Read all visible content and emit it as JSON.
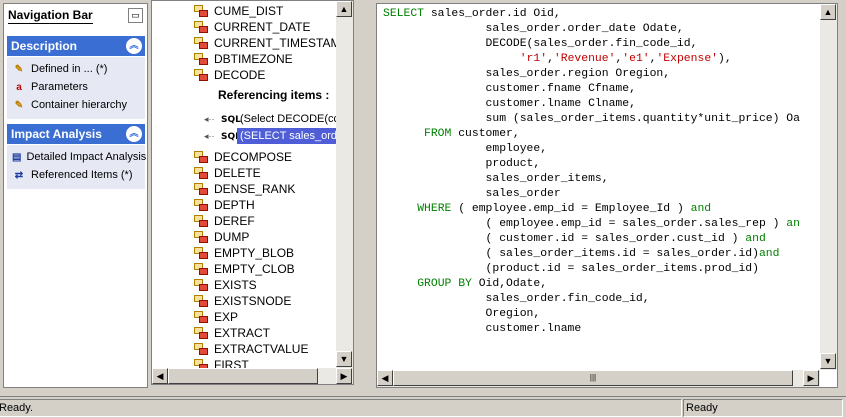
{
  "navigation": {
    "title": "Navigation Bar",
    "sections": [
      {
        "title": "Description",
        "items": [
          {
            "label": "Defined in ... (*)",
            "icon": "pencil-icon"
          },
          {
            "label": "Parameters",
            "icon": "parameter-icon"
          },
          {
            "label": "Container hierarchy",
            "icon": "pencil-icon"
          }
        ]
      },
      {
        "title": "Impact Analysis",
        "items": [
          {
            "label": "Detailed Impact Analysis",
            "icon": "impact-analysis-icon"
          },
          {
            "label": "Referenced Items (*)",
            "icon": "referenced-items-icon"
          }
        ]
      }
    ]
  },
  "list": {
    "top_items": [
      "CUME_DIST",
      "CURRENT_DATE",
      "CURRENT_TIMESTAMP",
      "DBTIMEZONE",
      "DECODE"
    ],
    "referencing_header": "Referencing items :",
    "references": [
      {
        "tag": "SQL",
        "label": "(Select DECODE(cc"
      },
      {
        "tag": "SQL",
        "label": "(SELECT sales_orde"
      }
    ],
    "bottom_items": [
      "DECOMPOSE",
      "DELETE",
      "DENSE_RANK",
      "DEPTH",
      "DEREF",
      "DUMP",
      "EMPTY_BLOB",
      "EMPTY_CLOB",
      "EXISTS",
      "EXISTSNODE",
      "EXP",
      "EXTRACT",
      "EXTRACTVALUE",
      "FIRST"
    ]
  },
  "editor": {
    "code_lines": [
      [
        {
          "t": "SELECT sales_order.id Oid,",
          "k": "kw-first"
        }
      ],
      [
        {
          "t": "               sales_order.order_date Odate,"
        }
      ],
      [
        {
          "t": "               DECODE(sales_order.fin_code_id,"
        }
      ],
      [
        {
          "t": "                    "
        },
        {
          "t": "'r1'",
          "c": "str"
        },
        {
          "t": ","
        },
        {
          "t": "'Revenue'",
          "c": "str"
        },
        {
          "t": ","
        },
        {
          "t": "'e1'",
          "c": "str"
        },
        {
          "t": ","
        },
        {
          "t": "'Expense'",
          "c": "str"
        },
        {
          "t": "),"
        }
      ],
      [
        {
          "t": "               sales_order.region Oregion,"
        }
      ],
      [
        {
          "t": "               customer.fname Cfname,"
        }
      ],
      [
        {
          "t": "               customer.lname Clname,"
        }
      ],
      [
        {
          "t": "               sum (sales_order_items.quantity*unit_price) Oa"
        }
      ],
      [
        {
          "t": "      "
        },
        {
          "t": "FROM",
          "c": "kw"
        },
        {
          "t": " customer,"
        }
      ],
      [
        {
          "t": "               employee,"
        }
      ],
      [
        {
          "t": "               product,"
        }
      ],
      [
        {
          "t": "               sales_order_items,"
        }
      ],
      [
        {
          "t": "               sales_order"
        }
      ],
      [
        {
          "t": "     "
        },
        {
          "t": "WHERE",
          "c": "kw"
        },
        {
          "t": " ( employee.emp_id = Employee_Id ) "
        },
        {
          "t": "and",
          "c": "kw"
        }
      ],
      [
        {
          "t": "               ( employee.emp_id = sales_order.sales_rep ) "
        },
        {
          "t": "an",
          "c": "kw"
        }
      ],
      [
        {
          "t": "               ( customer.id = sales_order.cust_id ) "
        },
        {
          "t": "and",
          "c": "kw"
        }
      ],
      [
        {
          "t": "               ( sales_order_items.id = sales_order.id)"
        },
        {
          "t": "and",
          "c": "kw"
        }
      ],
      [
        {
          "t": "               (product.id = sales_order_items.prod_id)"
        }
      ],
      [
        {
          "t": "     "
        },
        {
          "t": "GROUP BY",
          "c": "kw"
        },
        {
          "t": " Oid,Odate,"
        }
      ],
      [
        {
          "t": "               sales_order.fin_code_id,"
        }
      ],
      [
        {
          "t": "               Oregion,"
        }
      ],
      [
        {
          "t": "               customer.lname"
        }
      ]
    ]
  },
  "status": {
    "left": "Ready.",
    "right": "Ready"
  },
  "colors": {
    "section_header": "#3a6ed3",
    "keyword": "#008000",
    "string": "#c00000",
    "selection": "#4f5ed6"
  }
}
